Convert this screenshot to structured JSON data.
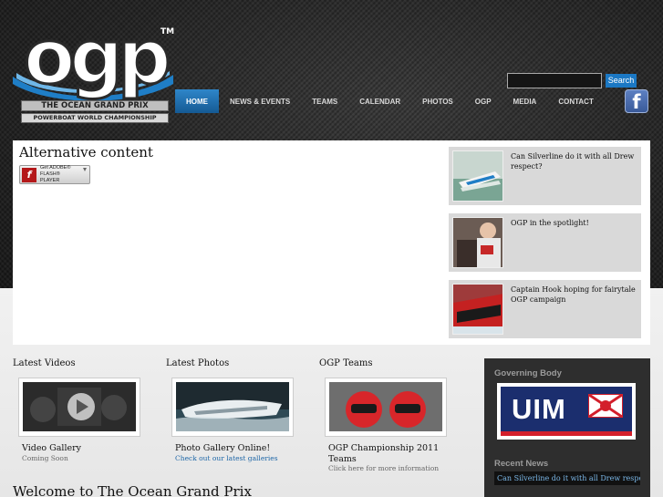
{
  "logo": {
    "wordmark": "ogp",
    "trademark": "TM",
    "tagline": "THE OCEAN GRAND PRIX",
    "subtagline": "POWERBOAT WORLD CHAMPIONSHIP"
  },
  "search": {
    "value": "",
    "button_label": "Search"
  },
  "nav": {
    "items": [
      {
        "label": "HOME"
      },
      {
        "label": "NEWS & EVENTS"
      },
      {
        "label": "TEAMS"
      },
      {
        "label": "CALENDAR"
      },
      {
        "label": "PHOTOS"
      },
      {
        "label": "OGP"
      },
      {
        "label": "MEDIA"
      },
      {
        "label": "CONTACT"
      }
    ],
    "active_index": 0
  },
  "social": {
    "facebook_glyph": "f"
  },
  "feature": {
    "title": "Alternative content",
    "flash_badge": {
      "icon_glyph": "f",
      "line1": "Get ADOBE®",
      "line2": "FLASH® PLAYER"
    }
  },
  "news": [
    {
      "title": "Can Silverline do it with all Drew respect?"
    },
    {
      "title": "OGP in the spotlight!"
    },
    {
      "title": "Captain Hook hoping for fairytale OGP campaign"
    }
  ],
  "columns": [
    {
      "heading": "Latest Videos",
      "label": "Video Gallery",
      "sub": "Coming Soon"
    },
    {
      "heading": "Latest Photos",
      "label": "Photo Gallery Online!",
      "sub": "Check out our latest galleries"
    },
    {
      "heading": "OGP Teams",
      "label": "OGP Championship 2011 Teams",
      "sub": "Click here for more information"
    }
  ],
  "welcome": "Welcome to The Ocean Grand Prix",
  "sidebar": {
    "governing_title": "Governing Body",
    "uim_text": "UIM",
    "recent_news_title": "Recent News",
    "recent_news_link": "Can Silverline do it with all Drew respect?"
  },
  "colors": {
    "accent_blue": "#1b78c4",
    "uim_navy": "#1b2e6e",
    "uim_red": "#d31f2b"
  }
}
